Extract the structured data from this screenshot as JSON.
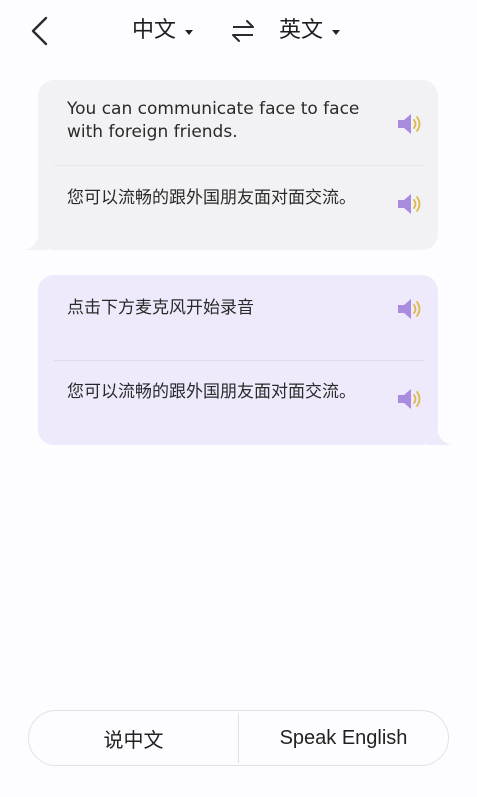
{
  "header": {
    "back_icon": "chevron-left-icon",
    "source_lang": "中文",
    "target_lang": "英文",
    "swap_icon": "swap-arrows-icon"
  },
  "conversation": [
    {
      "side": "left",
      "bubble_color": "#f2f2f4",
      "source_text": "You can communicate face to face with foreign friends.",
      "translated_text": "您可以流畅的跟外国朋友面对面交流。"
    },
    {
      "side": "right",
      "bubble_color": "#eeeafc",
      "source_text": "点击下方麦克风开始录音",
      "translated_text": "您可以流畅的跟外国朋友面对面交流。"
    }
  ],
  "speaker_icon": "speaker-icon",
  "speaker_color": "#a98ce0",
  "bottom_bar": {
    "speak_chinese_label": "说中文",
    "speak_english_label": "Speak English"
  }
}
